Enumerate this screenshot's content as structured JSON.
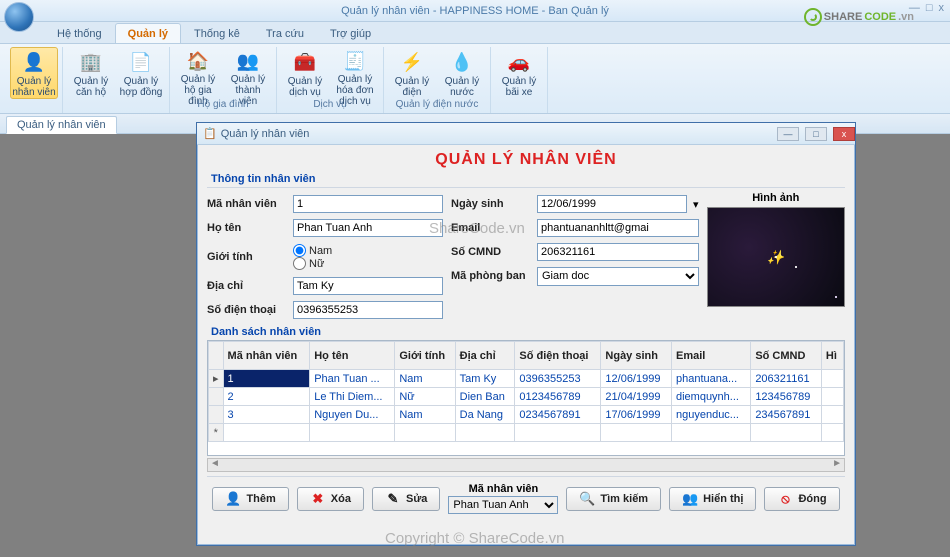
{
  "window": {
    "title": "Quản lý nhân viên - HAPPINESS HOME - Ban Quản lý",
    "min": "—",
    "max": "□",
    "close": "x"
  },
  "tabs": [
    "Hệ thống",
    "Quản lý",
    "Thống kê",
    "Tra cứu",
    "Trợ giúp"
  ],
  "activeTab": 1,
  "ribbon": {
    "groups": [
      {
        "label": "",
        "buttons": [
          {
            "label": "Quản lý nhân viên",
            "sel": true
          }
        ]
      },
      {
        "label": "",
        "buttons": [
          {
            "label": "Quản lý căn hộ"
          },
          {
            "label": "Quản lý hợp đồng"
          }
        ]
      },
      {
        "label": "Hộ gia đình",
        "buttons": [
          {
            "label": "Quản lý hộ gia đình"
          },
          {
            "label": "Quản lý thành viên"
          }
        ]
      },
      {
        "label": "Dịch vụ",
        "buttons": [
          {
            "label": "Quản lý dịch vụ"
          },
          {
            "label": "Quản lý hóa đơn dịch vụ"
          }
        ]
      },
      {
        "label": "Quản lý điện nước",
        "buttons": [
          {
            "label": "Quản lý điện"
          },
          {
            "label": "Quản lý nước"
          }
        ]
      },
      {
        "label": "",
        "buttons": [
          {
            "label": "Quản lý bãi xe"
          }
        ]
      }
    ],
    "icons": [
      "👤",
      "🏢",
      "📄",
      "🏠",
      "👥",
      "🧰",
      "🧾",
      "⚡",
      "💧",
      "🚗"
    ]
  },
  "subtab": "Quản lý nhân viên",
  "child": {
    "title": "Quản lý nhân viên",
    "heading": "QUẢN LÝ NHÂN VIÊN",
    "groupInfo": "Thông tin nhân viên",
    "groupList": "Danh sách nhân viên",
    "labels": {
      "id": "Mã nhân viên",
      "name": "Họ tên",
      "gender": "Giới tính",
      "address": "Địa chỉ",
      "phone": "Số điện thoại",
      "dob": "Ngày sinh",
      "email": "Email",
      "cmnd": "Số CMND",
      "dept": "Mã phòng ban",
      "image": "Hình ảnh",
      "male": "Nam",
      "female": "Nữ"
    },
    "values": {
      "id": "1",
      "name": "Phan Tuan Anh",
      "address": "Tam Ky",
      "phone": "0396355253",
      "dob": "12/06/1999",
      "email": "phantuananhltt@gmai",
      "cmnd": "206321161",
      "dept": "Giam doc",
      "genderMale": true
    },
    "table": {
      "cols": [
        "Mã nhân viên",
        "Họ tên",
        "Giới tính",
        "Địa chỉ",
        "Số điện thoại",
        "Ngày sinh",
        "Email",
        "Số CMND",
        "Hì"
      ],
      "rows": [
        [
          "1",
          "Phan Tuan ...",
          "Nam",
          "Tam Ky",
          "0396355253",
          "12/06/1999",
          "phantuana...",
          "206321161"
        ],
        [
          "2",
          "Le Thi Diem...",
          "Nữ",
          "Dien Ban",
          "0123456789",
          "21/04/1999",
          "diemquynh...",
          "123456789"
        ],
        [
          "3",
          "Nguyen Du...",
          "Nam",
          "Da Nang",
          "0234567891",
          "17/06/1999",
          "nguyenduc...",
          "234567891"
        ]
      ]
    },
    "buttons": {
      "add": "Thêm",
      "del": "Xóa",
      "edit": "Sửa",
      "searchLabel": "Mã nhân viên",
      "searchVal": "Phan Tuan Anh",
      "search": "Tìm kiếm",
      "show": "Hiển thị",
      "close": "Đóng"
    }
  },
  "watermark1": "ShareCode.vn",
  "watermark2": "Copyright © ShareCode.vn",
  "logo": {
    "a": "SHARE",
    "b": "CODE",
    "c": ".vn"
  }
}
